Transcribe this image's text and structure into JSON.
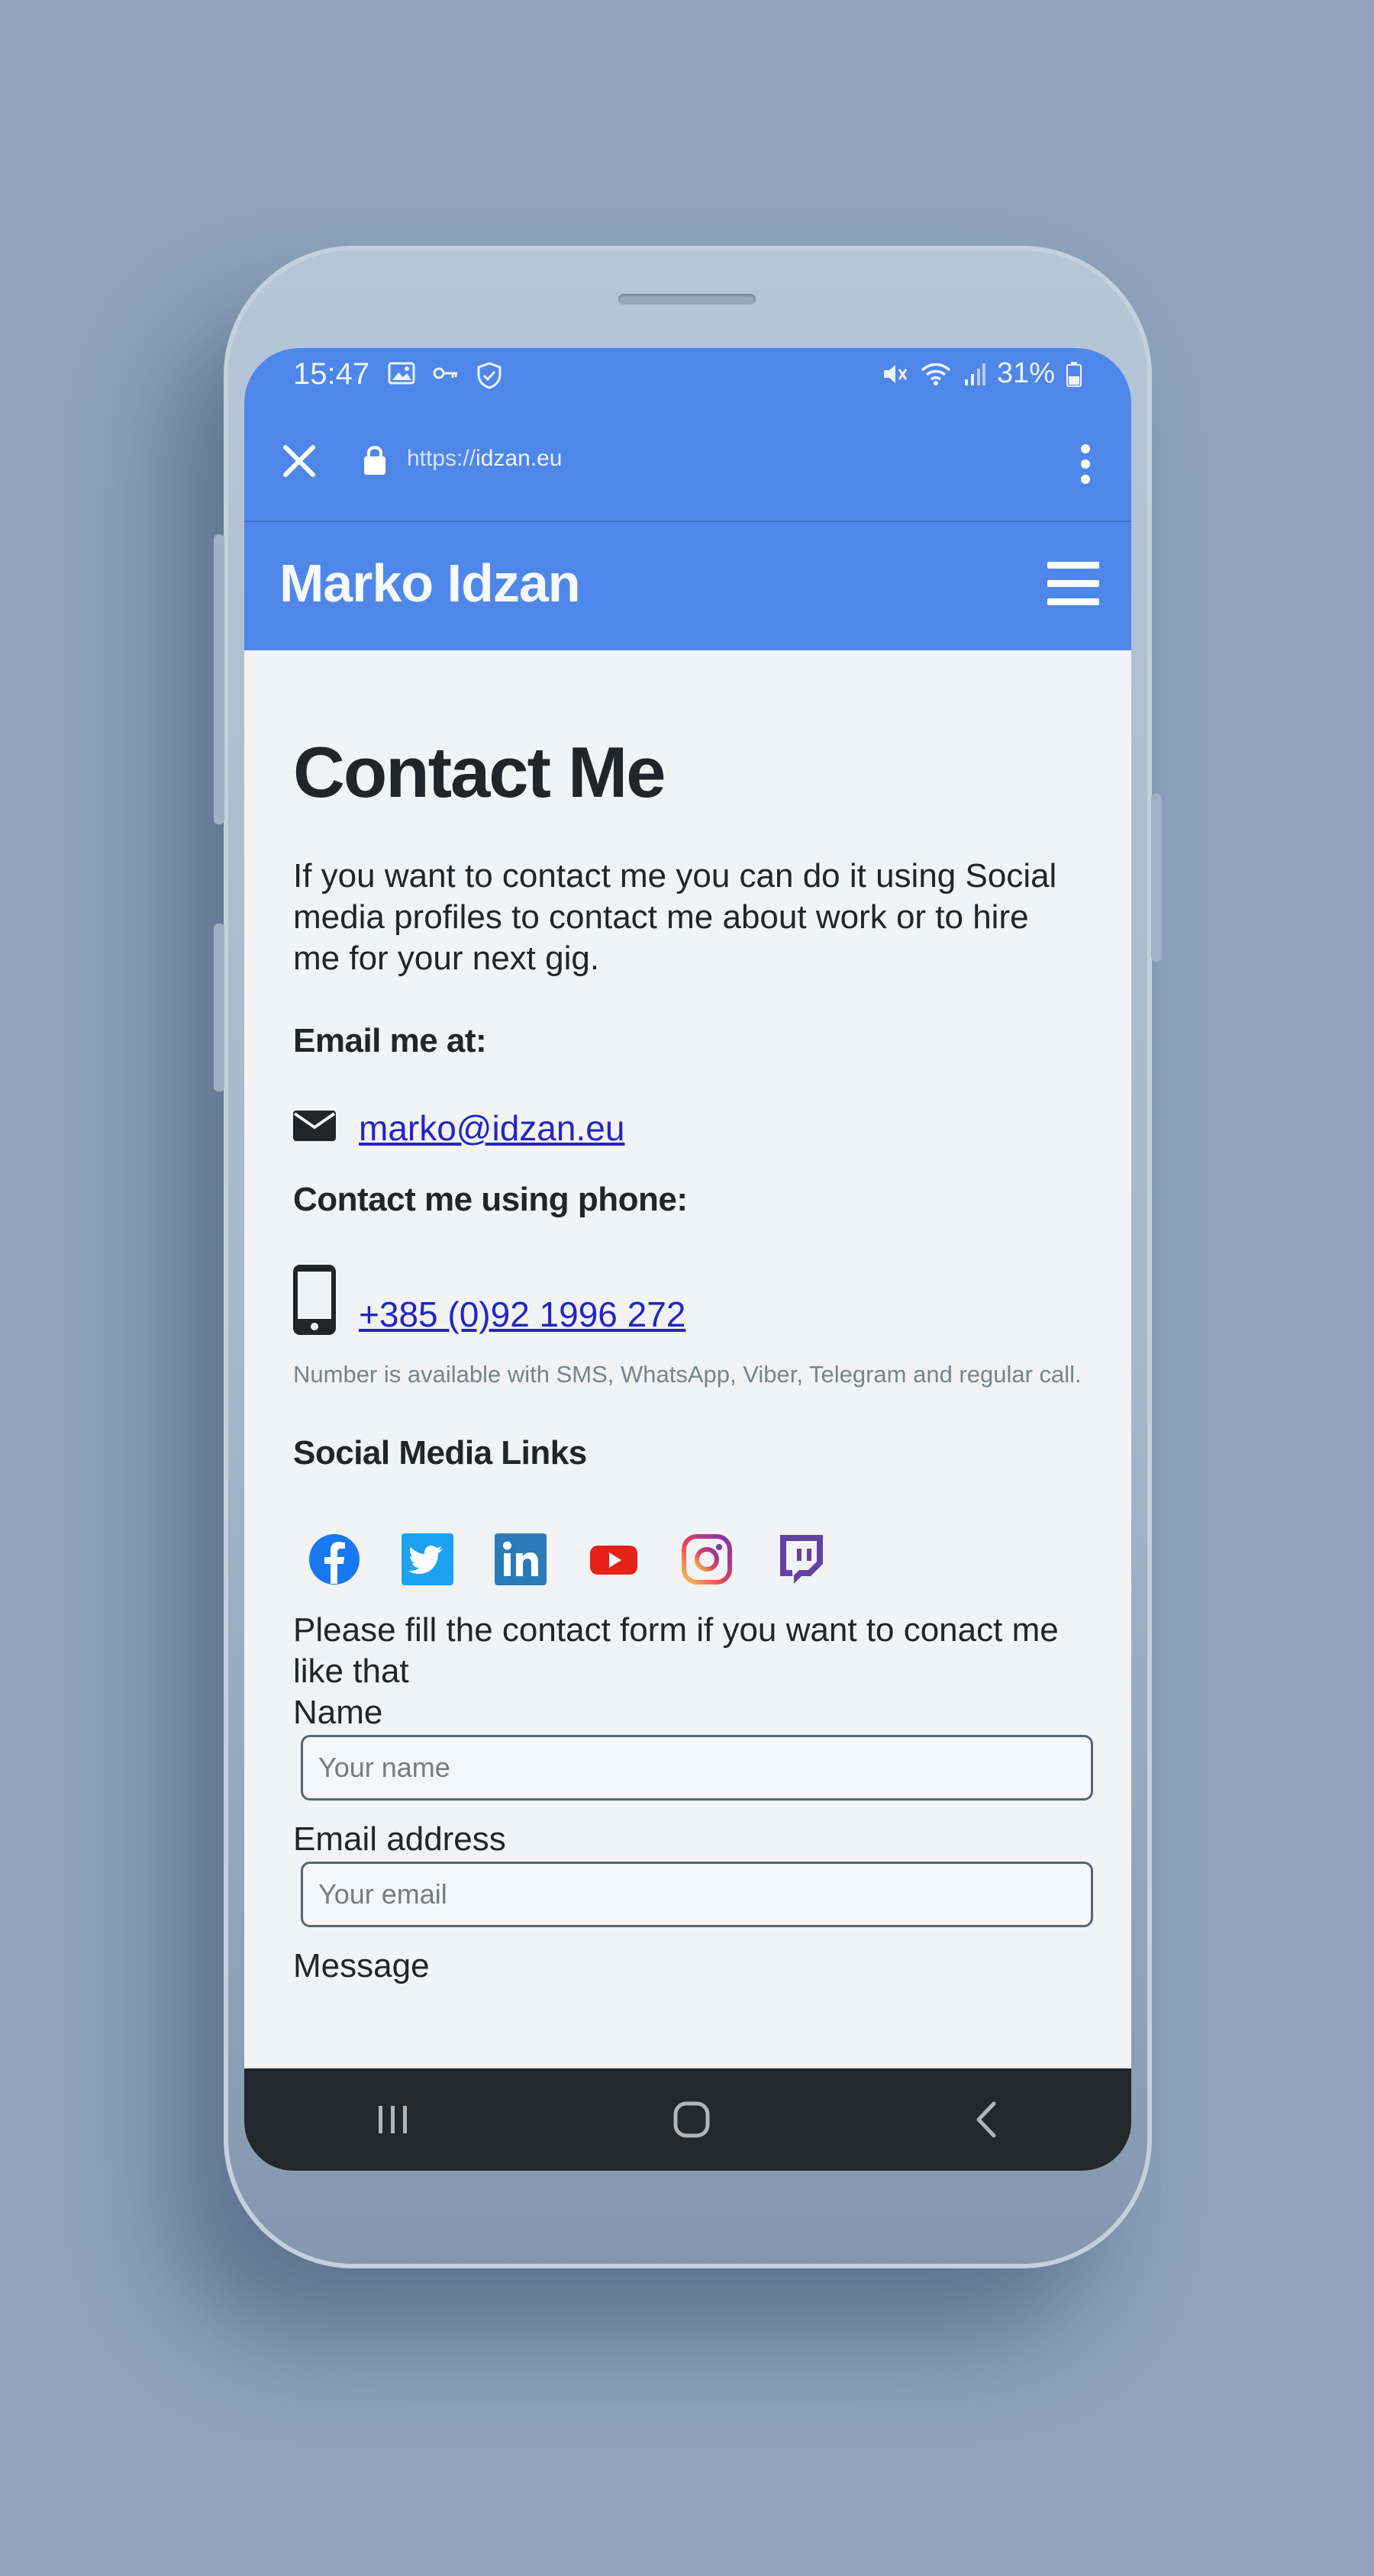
{
  "status": {
    "time": "15:47",
    "battery": "31%"
  },
  "browser": {
    "url_scheme": "https://",
    "url_host": "idzan.eu"
  },
  "site": {
    "title": "Marko Idzan"
  },
  "content": {
    "heading": "Contact Me",
    "intro": "If you want to contact me you can do it using Social media profiles to contact me about work or to hire me for your next gig.",
    "email_heading": "Email me at:",
    "email": "marko@idzan.eu",
    "phone_heading": "Contact me using phone:",
    "phone": "+385 (0)92 1996 272",
    "phone_note": "Number is available with SMS, WhatsApp, Viber, Telegram and regular call.",
    "social_heading": "Social Media Links",
    "social_icons": [
      "facebook-icon",
      "twitter-icon",
      "linkedin-icon",
      "youtube-icon",
      "instagram-icon",
      "twitch-icon"
    ],
    "form_intro": "Please fill the contact form if you want to conact me like that",
    "form": {
      "name_label": "Name",
      "name_placeholder": "Your name",
      "email_label": "Email address",
      "email_placeholder": "Your email",
      "message_label": "Message"
    }
  },
  "colors": {
    "accent": "#4f86ea",
    "link": "#2424c7",
    "navbar": "#23282d",
    "background": "#8ea3bb"
  }
}
